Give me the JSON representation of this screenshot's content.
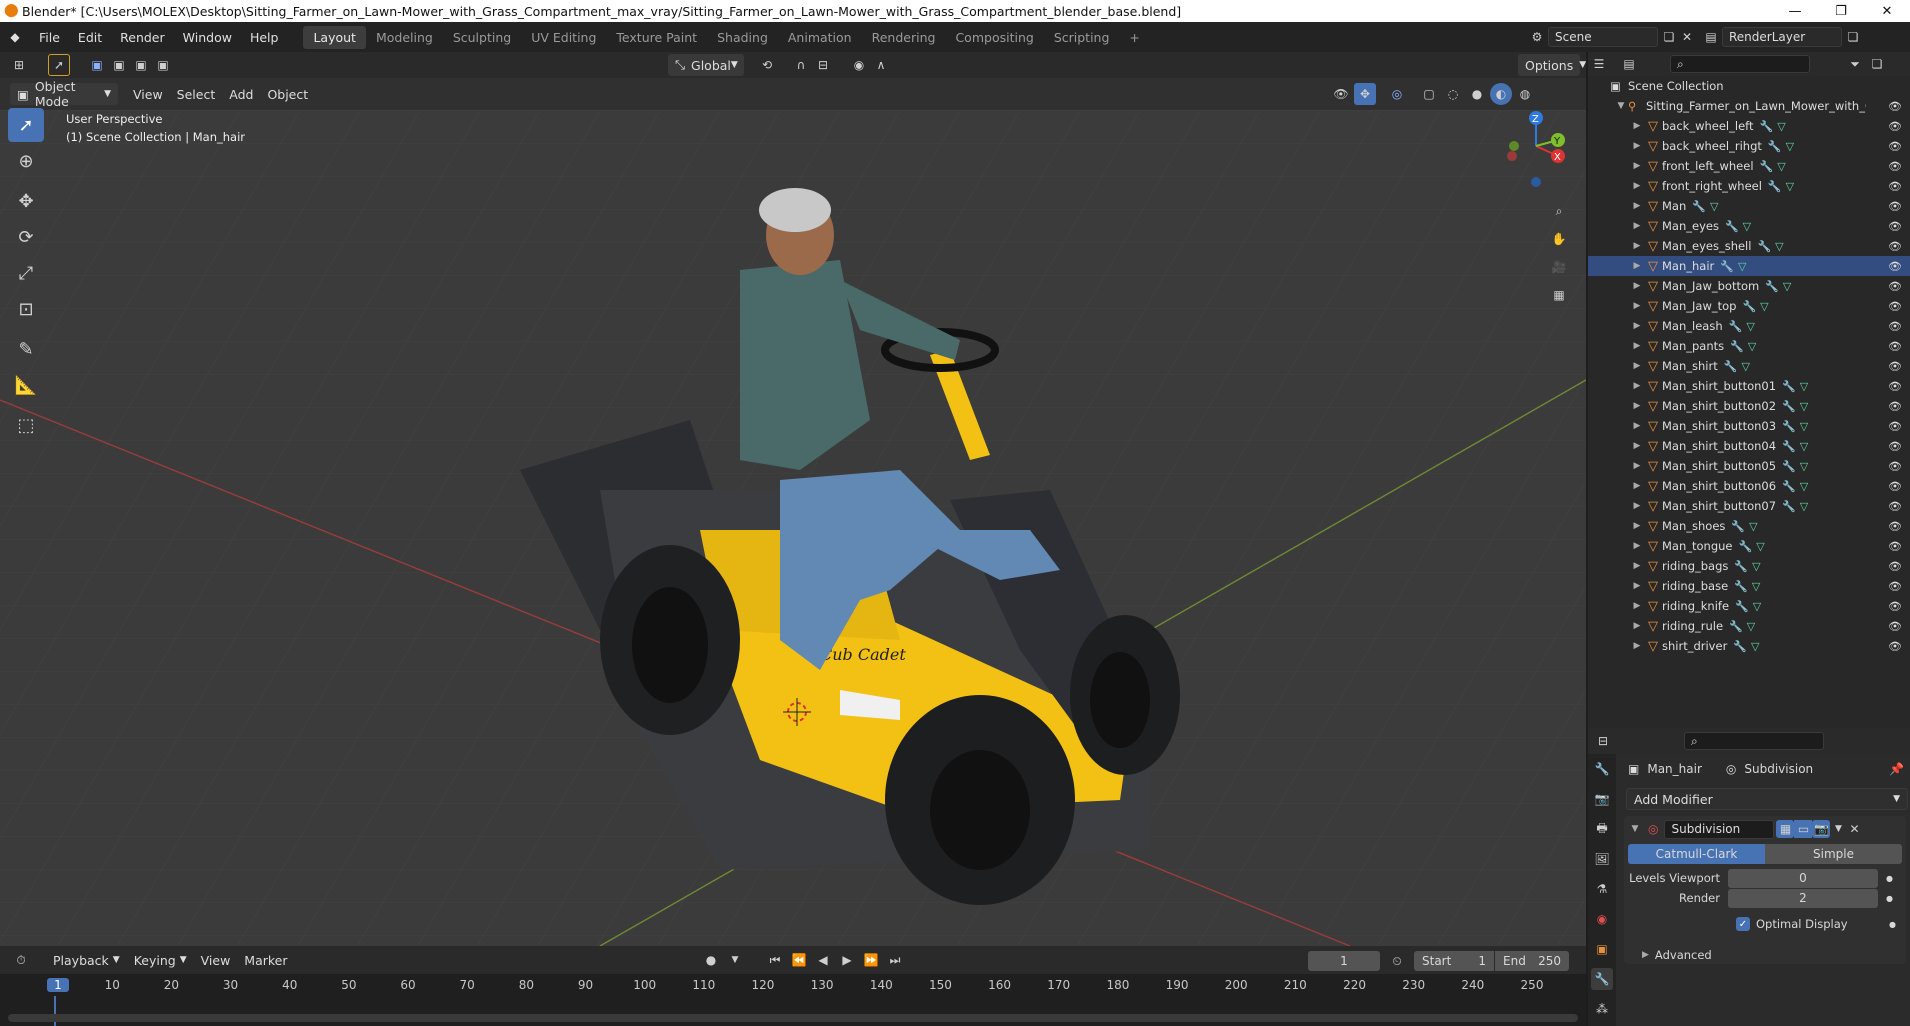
{
  "title": "Blender* [C:\\Users\\MOLEX\\Desktop\\Sitting_Farmer_on_Lawn-Mower_with_Grass_Compartment_max_vray/Sitting_Farmer_on_Lawn-Mower_with_Grass_Compartment_blender_base.blend]",
  "menus": [
    "File",
    "Edit",
    "Render",
    "Window",
    "Help"
  ],
  "workspaces": [
    "Layout",
    "Modeling",
    "Sculpting",
    "UV Editing",
    "Texture Paint",
    "Shading",
    "Animation",
    "Rendering",
    "Compositing",
    "Scripting"
  ],
  "active_workspace": "Layout",
  "scene": "Scene",
  "render_layer": "RenderLayer",
  "transform_orientation": "Global",
  "options": "Options",
  "view_header": {
    "mode": "Object Mode",
    "menus": [
      "View",
      "Select",
      "Add",
      "Object"
    ]
  },
  "viewport": {
    "perspective": "User Perspective",
    "collection": "(1) Scene Collection | Man_hair",
    "gizmo": {
      "x": "X",
      "y": "Y",
      "z": "Z"
    },
    "brand": "Cub Cadet"
  },
  "outliner": {
    "root": "Scene Collection",
    "parent": "Sitting_Farmer_on_Lawn_Mower_with_Grass",
    "items": [
      "back_wheel_left",
      "back_wheel_rihgt",
      "front_left_wheel",
      "front_right_wheel",
      "Man",
      "Man_eyes",
      "Man_eyes_shell",
      "Man_hair",
      "Man_Jaw_bottom",
      "Man_Jaw_top",
      "Man_leash",
      "Man_pants",
      "Man_shirt",
      "Man_shirt_button01",
      "Man_shirt_button02",
      "Man_shirt_button03",
      "Man_shirt_button04",
      "Man_shirt_button05",
      "Man_shirt_button06",
      "Man_shirt_button07",
      "Man_shoes",
      "Man_tongue",
      "riding_bags",
      "riding_base",
      "riding_knife",
      "riding_rule",
      "shirt_driver"
    ],
    "selected": "Man_hair"
  },
  "properties": {
    "object": "Man_hair",
    "modifier_tab": "Subdivision",
    "add_modifier": "Add Modifier",
    "modifier_name": "Subdivision",
    "algo": [
      "Catmull-Clark",
      "Simple"
    ],
    "active_algo": "Catmull-Clark",
    "levels_viewport_label": "Levels Viewport",
    "levels_viewport": "0",
    "render_label": "Render",
    "render": "2",
    "optimal": "Optimal Display",
    "advanced": "Advanced"
  },
  "timeline": {
    "menus": [
      "Playback",
      "Keying",
      "View",
      "Marker"
    ],
    "current": "1",
    "start_label": "Start",
    "start": "1",
    "end_label": "End",
    "end": "250",
    "ticks": [
      "1",
      "10",
      "20",
      "30",
      "40",
      "50",
      "60",
      "70",
      "80",
      "90",
      "100",
      "110",
      "120",
      "130",
      "140",
      "150",
      "160",
      "170",
      "180",
      "190",
      "200",
      "210",
      "220",
      "230",
      "240",
      "250"
    ]
  }
}
